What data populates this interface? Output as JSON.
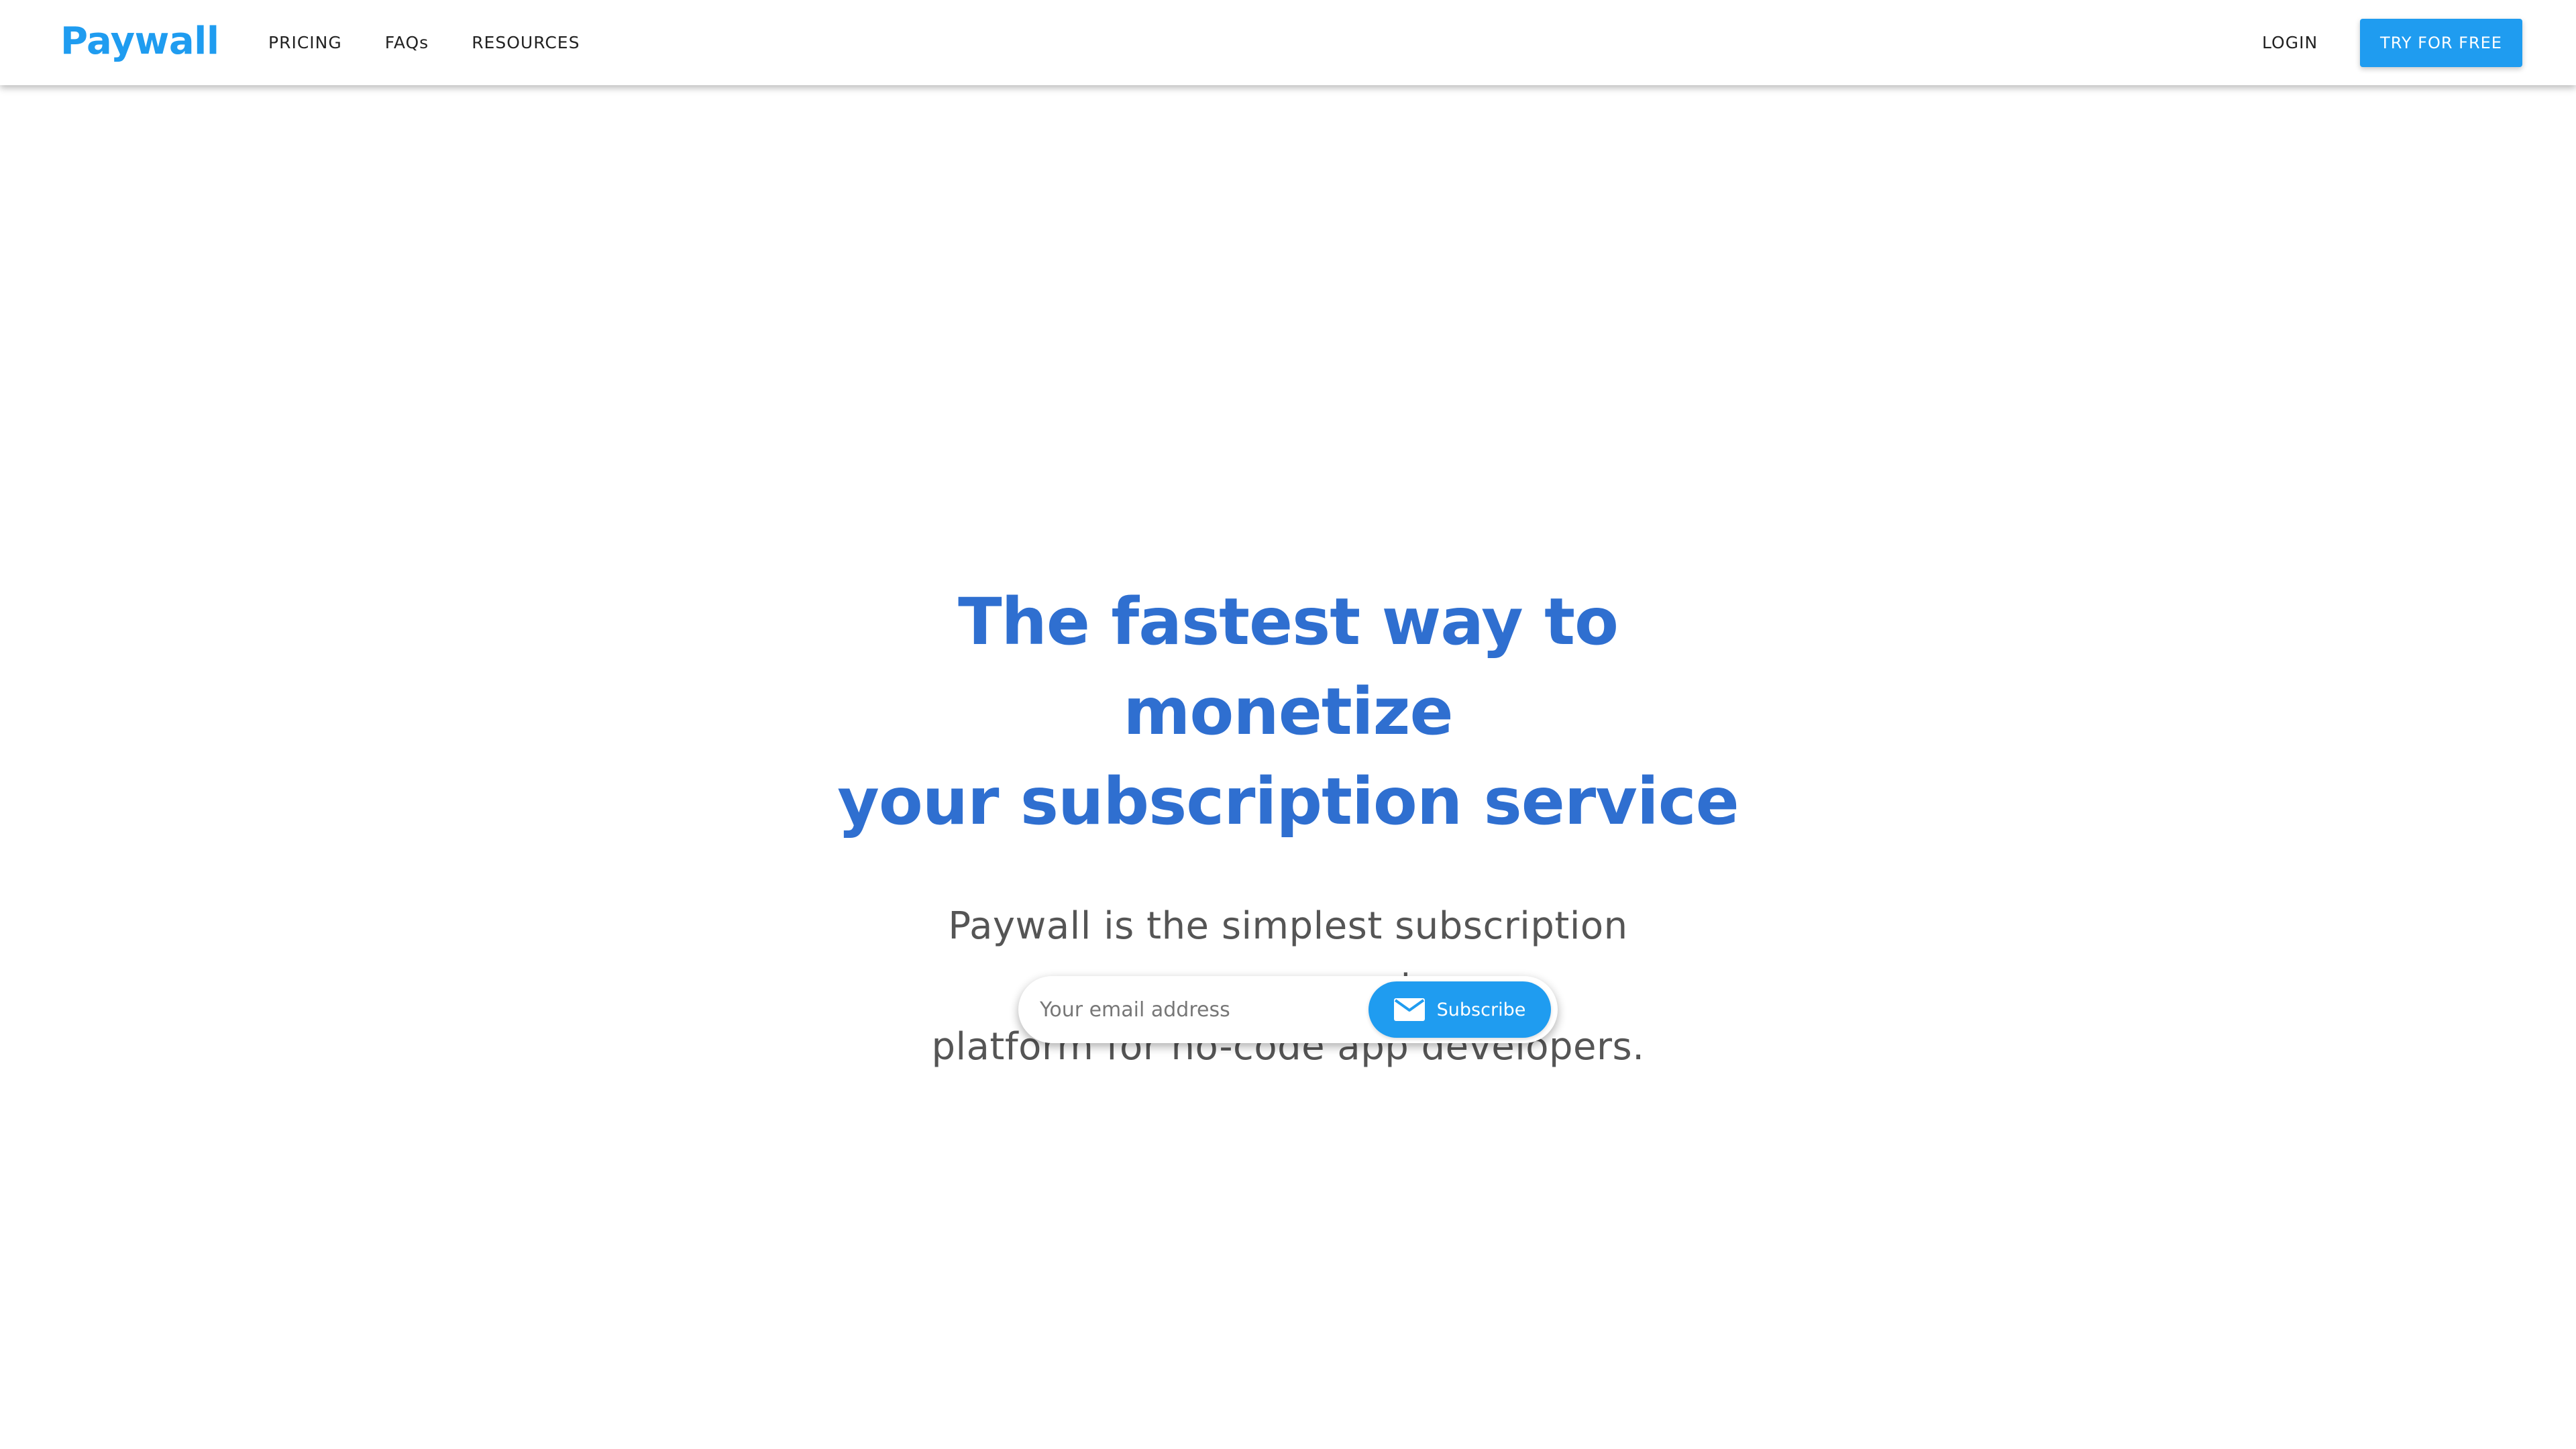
{
  "header": {
    "logo": "Paywall",
    "nav": [
      {
        "label": "PRICING"
      },
      {
        "label": "FAQs"
      },
      {
        "label": "RESOURCES"
      }
    ],
    "login_label": "LOGIN",
    "cta_label": "TRY FOR FREE"
  },
  "hero": {
    "headline_line1": "The fastest way to monetize",
    "headline_line2": "your subscription service",
    "subtext_line1": "Paywall is the simplest subscription management",
    "subtext_line2": "platform for no-code app developers."
  },
  "subscribe": {
    "placeholder": "Your email address",
    "value": "",
    "button_label": "Subscribe",
    "button_icon": "mail-icon"
  },
  "colors": {
    "brand": "#1f9cf0",
    "headline": "#2f6fd0",
    "body_text": "#555555"
  }
}
